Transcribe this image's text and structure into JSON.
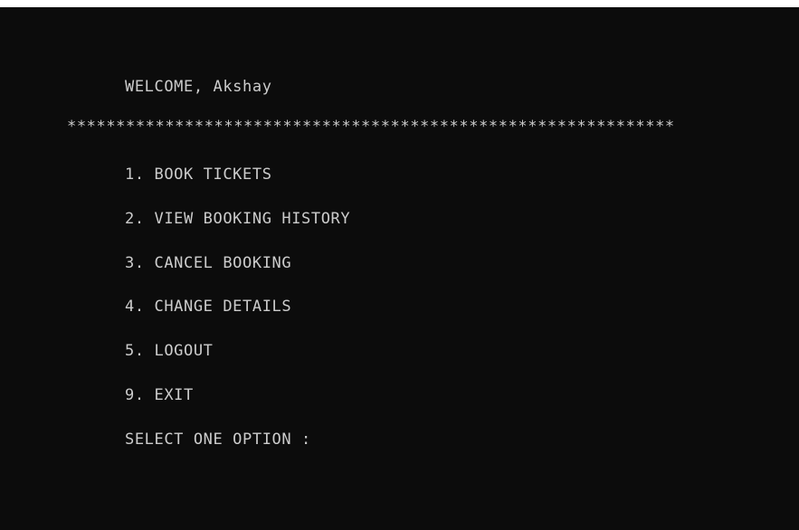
{
  "console": {
    "welcome": "WELCOME, Akshay",
    "separator": "**************************************************************",
    "menu": [
      "1. BOOK TICKETS",
      "2. VIEW BOOKING HISTORY",
      "3. CANCEL BOOKING",
      "4. CHANGE DETAILS",
      "5. LOGOUT",
      "9. EXIT"
    ],
    "prompt": "SELECT ONE OPTION :"
  },
  "colors": {
    "background": "#0c0c0c",
    "text": "#cccccc"
  }
}
